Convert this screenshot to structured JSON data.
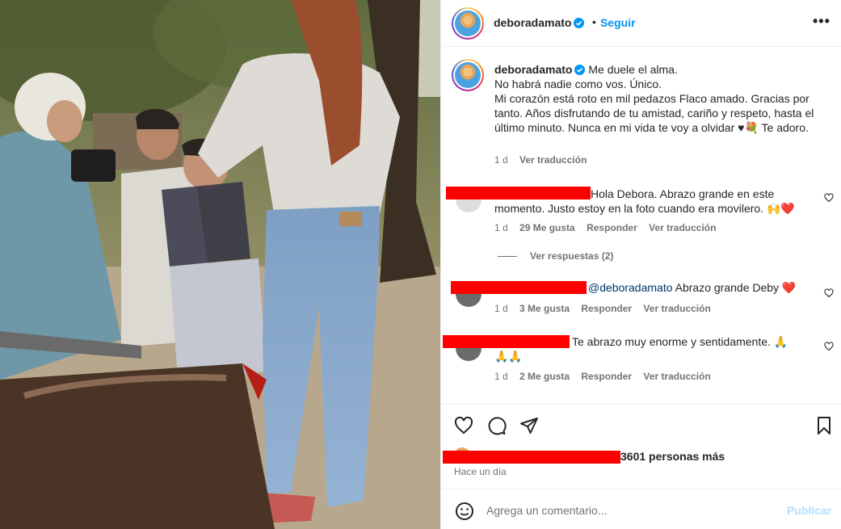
{
  "post": {
    "username": "deboradamato",
    "dot": "•",
    "follow_label": "Seguir",
    "more_label": "•••"
  },
  "caption": {
    "username": "deboradamato",
    "text_1": "Me duele el alma.",
    "text_2": "No habrá nadie como vos. Único.",
    "text_3": "Mi corazón está roto en mil pedazos Flaco amado. Gracias por tanto. Años disfrutando de tu amistad, cariño y respeto, hasta el último minuto. Nunca en mi vida te voy a olvidar ♥💐 Te adoro.",
    "time": "1 d",
    "translate": "Ver traducción"
  },
  "comments": [
    {
      "text": "Hola Debora. Abrazo grande en este momento. Justo estoy en la foto cuando era movilero. 🙌❤️",
      "time": "1 d",
      "likes": "29 Me gusta",
      "reply": "Responder",
      "translate": "Ver traducción"
    },
    {
      "mention": "@deboradamato",
      "text": " Abrazo grande Deby ❤️",
      "time": "1 d",
      "likes": "3 Me gusta",
      "reply": "Responder",
      "translate": "Ver traducción"
    },
    {
      "text": "Te abrazo muy enorme y sentidamente. 🙏",
      "text_2": "🙏🙏",
      "time": "1 d",
      "likes": "2 Me gusta",
      "reply": "Responder",
      "translate": "Ver traducción"
    }
  ],
  "view_replies": "Ver respuestas (2)",
  "likes_summary": "3601 personas más",
  "posted_ago": "Hace un día",
  "add_comment": {
    "placeholder": "Agrega un comentario...",
    "post_label": "Publicar"
  },
  "colors": {
    "accent": "#0095f6",
    "redaction": "#ff0000",
    "publish_disabled": "#b2dffc"
  }
}
